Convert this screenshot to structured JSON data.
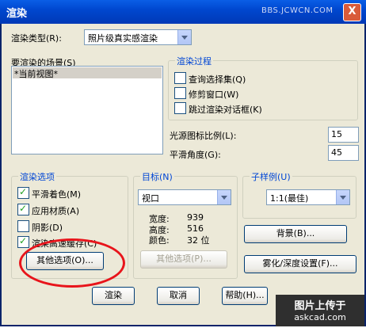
{
  "window": {
    "title": "渲染",
    "watermark": "BBS.JCWCN.COM",
    "close": "X"
  },
  "render_type": {
    "label": "渲染类型(R):",
    "value": "照片级真实感渲染"
  },
  "scene": {
    "label": "要渲染的场景(S)",
    "items": [
      "*当前视图*"
    ]
  },
  "render_process": {
    "title": "渲染过程",
    "options": [
      {
        "label": "查询选择集(Q)",
        "checked": false
      },
      {
        "label": "修剪窗口(W)",
        "checked": false
      },
      {
        "label": "跳过渲染对话框(K)",
        "checked": false
      }
    ]
  },
  "light_icon_scale": {
    "label": "光源图标比例(L):",
    "value": "15"
  },
  "smoothing_angle": {
    "label": "平滑角度(G):",
    "value": "45"
  },
  "render_options": {
    "title": "渲染选项",
    "items": [
      {
        "label": "平滑着色(M)",
        "checked": true
      },
      {
        "label": "应用材质(A)",
        "checked": true
      },
      {
        "label": "阴影(D)",
        "checked": false
      },
      {
        "label": "渲染高速缓存(C)",
        "checked": true
      }
    ],
    "more_button": "其他选项(O)..."
  },
  "destination": {
    "title": "目标(N)",
    "value": "视口",
    "width_label": "宽度:",
    "width": "939",
    "height_label": "高度:",
    "height": "516",
    "color_label": "颜色:",
    "color": "32 位",
    "more_button": "其他选项(P)..."
  },
  "subsampling": {
    "title": "子样例(U)",
    "value": "1:1(最佳)"
  },
  "background_button": "背景(B)...",
  "fog_button": "雾化/深度设置(F)...",
  "footer": {
    "render": "渲染",
    "cancel": "取消",
    "help": "帮助(H)..."
  },
  "bottom_watermark": {
    "line1": "图片上传于",
    "line2": "askcad.com"
  },
  "colors": {
    "title_bar": "#0047cf",
    "group_title": "#0046d5",
    "highlight": "#e8141b"
  }
}
